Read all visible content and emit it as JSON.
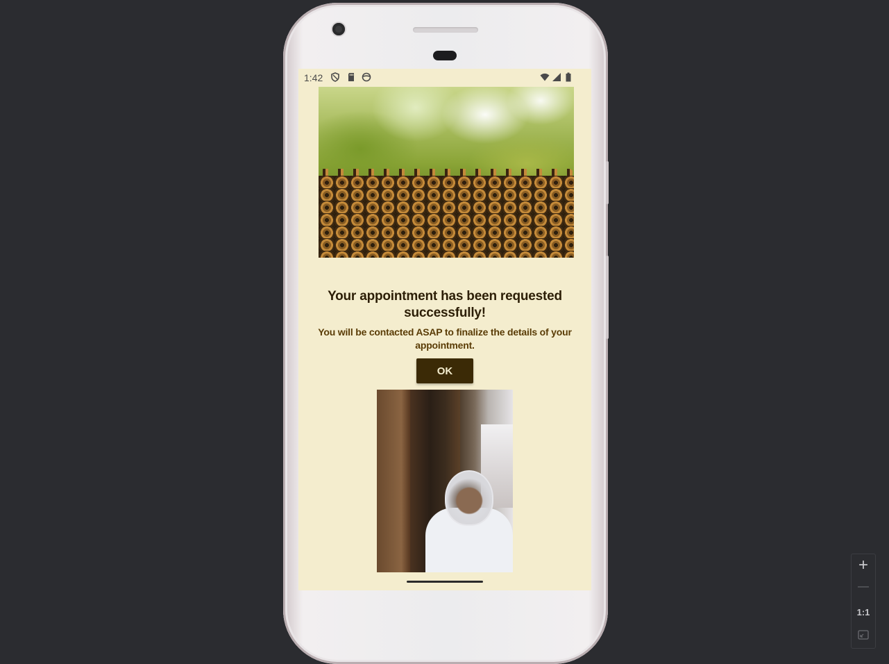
{
  "status_bar": {
    "time": "1:42",
    "left_icons": [
      "shield-icon",
      "sd-card-icon",
      "face-icon"
    ],
    "right_icons": [
      "wifi-icon",
      "signal-icon",
      "battery-icon"
    ]
  },
  "confirmation": {
    "title": "Your appointment has been requested successfully!",
    "message": "You will be contacted ASAP to finalize the details of your appointment.",
    "ok_label": "OK"
  },
  "images": {
    "hero": "bees-on-honeycomb-image",
    "beekeeper": "beekeeper-photo"
  },
  "zoom_controls": {
    "zoom_in": "+",
    "zoom_out": "—",
    "actual_size": "1:1"
  },
  "colors": {
    "screen_background": "#f4edce",
    "title_text": "#2c1e06",
    "message_text": "#5a3c06",
    "button_background": "#3b2a06",
    "button_text": "#f4edce"
  }
}
